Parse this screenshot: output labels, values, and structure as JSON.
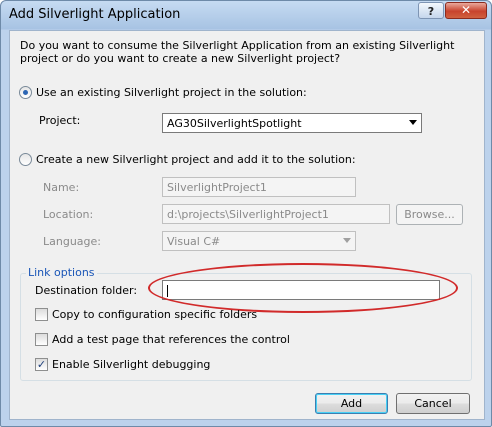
{
  "window": {
    "title": "Add Silverlight Application"
  },
  "titlebar": {
    "help": "?",
    "close": "✕"
  },
  "description": "Do you want to consume the Silverlight Application from an existing Silverlight project or do you want to create a new Silverlight project?",
  "option_existing": {
    "label": "Use an existing Silverlight project in the solution:",
    "selected": true
  },
  "project": {
    "label": "Project:",
    "value": "AG30SilverlightSpotlight"
  },
  "option_new": {
    "label": "Create a new Silverlight project and add it to the solution:",
    "selected": false
  },
  "new_project": {
    "name_label": "Name:",
    "name_value": "SilverlightProject1",
    "location_label": "Location:",
    "location_value": "d:\\projects\\SilverlightProject1",
    "browse_label": "Browse...",
    "language_label": "Language:",
    "language_value": "Visual C#"
  },
  "link_options": {
    "title": "Link options",
    "destination_label": "Destination folder:",
    "destination_value": "",
    "copy_config_label": "Copy to configuration specific folders",
    "copy_config_checked": false,
    "test_page_label": "Add a test page that references the control",
    "test_page_checked": false,
    "debugging_label": "Enable Silverlight debugging",
    "debugging_checked": true
  },
  "buttons": {
    "add": "Add",
    "cancel": "Cancel"
  },
  "colors": {
    "highlight_ellipse": "#d12a2a",
    "group_label": "#1a56b7"
  }
}
